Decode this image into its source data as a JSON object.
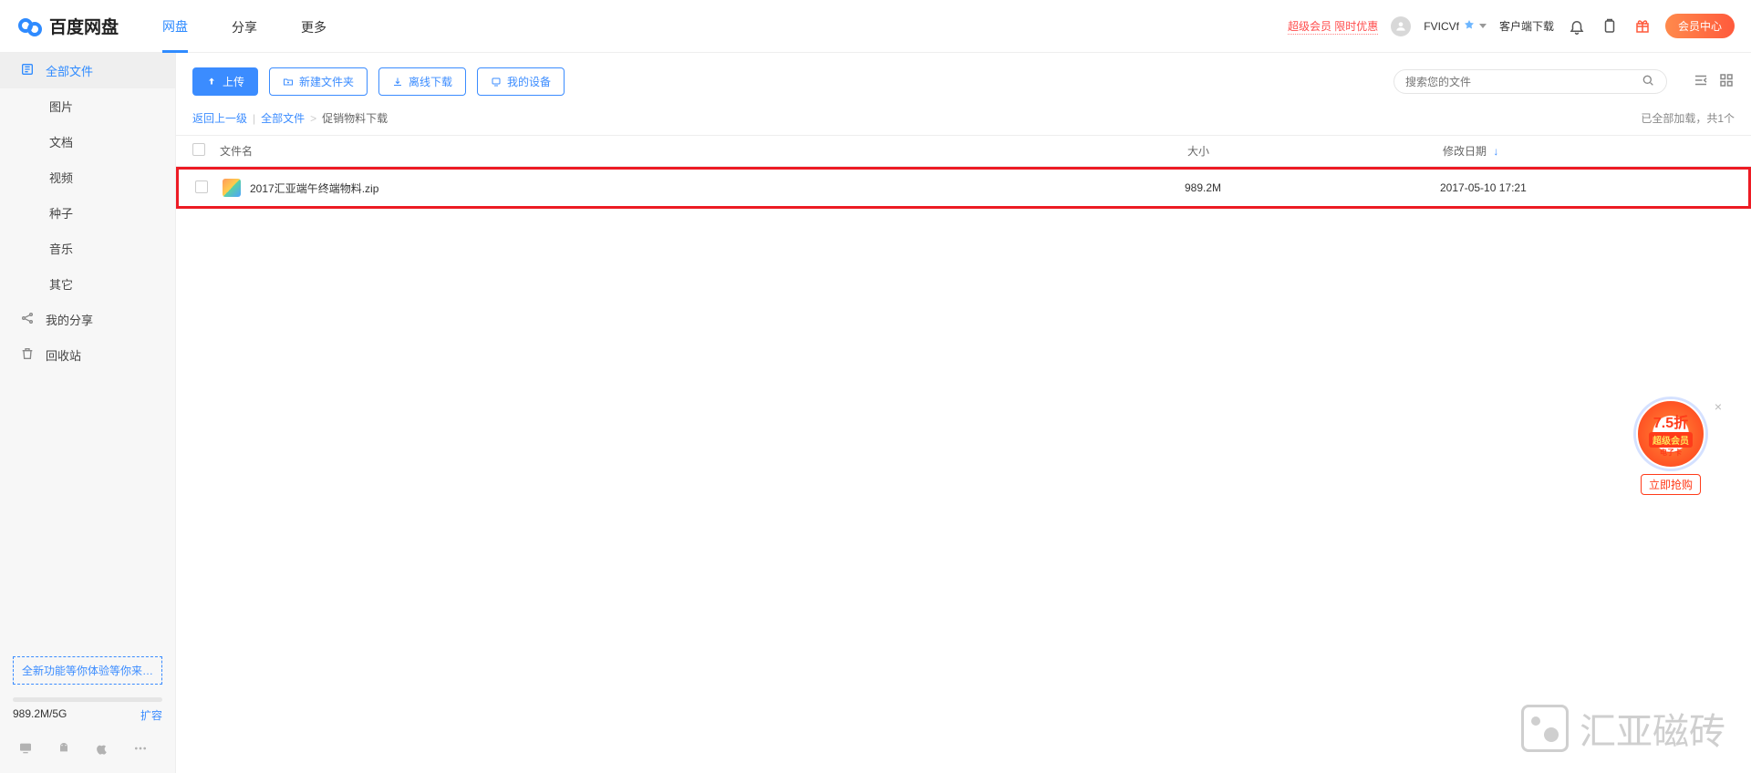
{
  "header": {
    "logo_text": "百度网盘",
    "tabs": [
      "网盘",
      "分享",
      "更多"
    ],
    "active_tab": 0,
    "promo": "超级会员 限时优惠",
    "username": "FVICVf",
    "client_link": "客户端下载",
    "member_center": "会员中心"
  },
  "sidebar": {
    "all_files": "全部文件",
    "categories": [
      "图片",
      "文档",
      "视频",
      "种子",
      "音乐",
      "其它"
    ],
    "my_share": "我的分享",
    "recycle": "回收站",
    "promo_box": "全新功能等你体验等你来…",
    "quota_text": "989.2M/5G",
    "expand": "扩容"
  },
  "toolbar": {
    "upload": "上传",
    "new_folder": "新建文件夹",
    "offline_download": "离线下载",
    "my_devices": "我的设备",
    "search_placeholder": "搜索您的文件"
  },
  "breadcrumb": {
    "back": "返回上一级",
    "root": "全部文件",
    "current": "促销物料下载",
    "loaded": "已全部加载，共1个"
  },
  "table": {
    "col_name": "文件名",
    "col_size": "大小",
    "col_date": "修改日期",
    "rows": [
      {
        "name": "2017汇亚端午终端物料.zip",
        "size": "989.2M",
        "date": "2017-05-10 17:21"
      }
    ]
  },
  "promo_sticker": {
    "discount": "7.5折",
    "line2": "超级会员",
    "line3": "电子卡",
    "cta": "立即抢购"
  },
  "watermark": "汇亚磁砖"
}
